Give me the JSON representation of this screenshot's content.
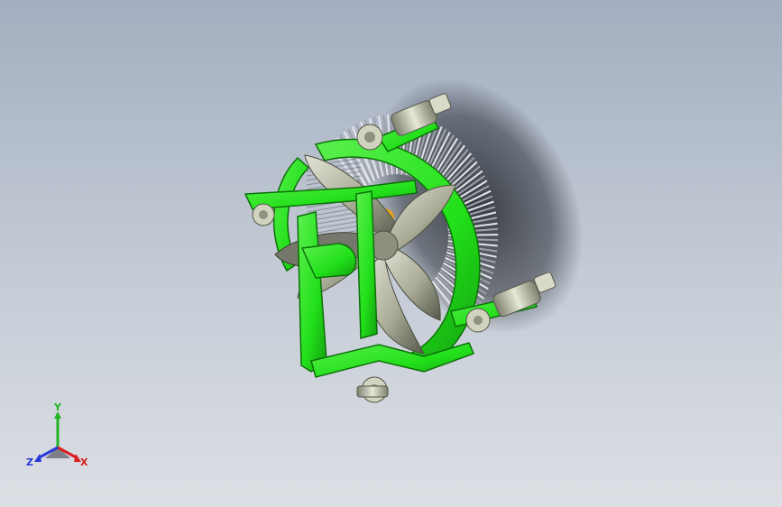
{
  "viewport": {
    "background_top": "#a3aec0",
    "background_bottom": "#dcdfe4"
  },
  "model": {
    "frame_color": "#22e01a",
    "frame_shadow": "#0f8f0c",
    "fin_color": "#c9ccd2",
    "blade_color": "#a9ab96",
    "screw_color": "#c4c8b2",
    "shadow_color": "#2a2e36"
  },
  "triad": {
    "x_label": "X",
    "y_label": "Y",
    "z_label": "Z",
    "x_color": "#d81e1e",
    "y_color": "#22b322",
    "z_color": "#2638d8"
  }
}
